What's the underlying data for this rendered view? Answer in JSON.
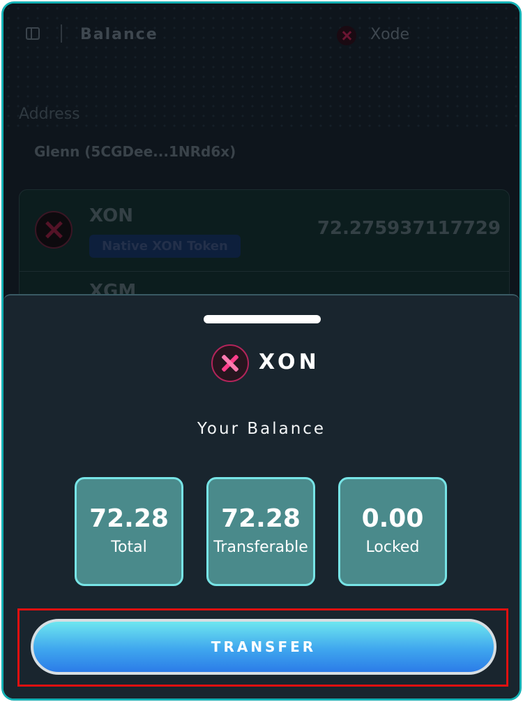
{
  "header": {
    "title": "Balance",
    "network_name": "Xode"
  },
  "address": {
    "label": "Address",
    "account": "Glenn  (5CGDee...1NRd6x)"
  },
  "tokens": [
    {
      "symbol": "XON",
      "badge": "Native XON Token",
      "amount": "72.275937117729"
    },
    {
      "symbol": "XGM"
    }
  ],
  "sheet": {
    "token_symbol": "XON",
    "heading": "Your Balance",
    "stats": [
      {
        "value": "72.28",
        "label": "Total"
      },
      {
        "value": "72.28",
        "label": "Transferable"
      },
      {
        "value": "0.00",
        "label": "Locked"
      }
    ],
    "transfer_label": "TRANSFER"
  },
  "colors": {
    "accent": "#15b0b4",
    "sheet_bg": "#19252e",
    "stat_bg": "#4a8a8b",
    "stat_border": "#77e4e6",
    "xon_pink": "#ff3d8a",
    "highlight": "#e01010"
  }
}
